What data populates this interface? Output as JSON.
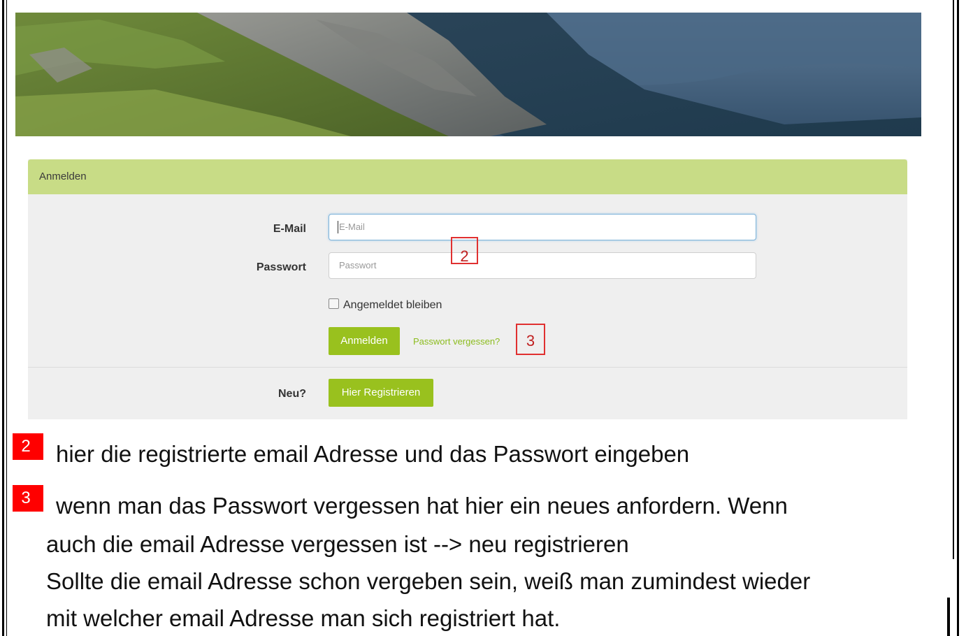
{
  "login": {
    "heading": "Anmelden",
    "email_label": "E-Mail",
    "email_placeholder": "E-Mail",
    "password_label": "Passwort",
    "password_placeholder": "Passwort",
    "remember_label": "Angemeldet bleiben",
    "submit_label": "Anmelden",
    "forgot_link": "Passwort vergessen?",
    "new_label": "Neu?",
    "register_label": "Hier Registrieren"
  },
  "annotations": {
    "marker_2": "2",
    "marker_3": "3"
  },
  "notes": {
    "note2_badge": "2",
    "note2_text": " hier die registrierte email Adresse und das Passwort eingeben",
    "note3_badge": "3",
    "note3_line1": "wenn man das Passwort vergessen hat hier ein neues anfordern. Wenn",
    "note3_line2": "auch die email Adresse vergessen ist --> neu registrieren",
    "note3_line3": "Sollte die email Adresse schon vergeben sein, weiß man zumindest wieder",
    "note3_line4": "mit welcher email Adresse man sich registriert hat."
  },
  "colors": {
    "heading_bg": "#c8dc86",
    "button_bg": "#99c11e",
    "link": "#8cbc1f",
    "annotation_red": "#ff0000"
  }
}
